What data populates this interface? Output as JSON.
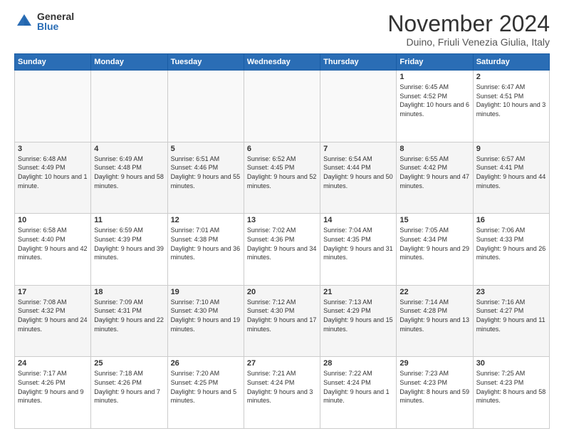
{
  "logo": {
    "general": "General",
    "blue": "Blue"
  },
  "title": "November 2024",
  "location": "Duino, Friuli Venezia Giulia, Italy",
  "weekdays": [
    "Sunday",
    "Monday",
    "Tuesday",
    "Wednesday",
    "Thursday",
    "Friday",
    "Saturday"
  ],
  "rows": [
    [
      {
        "day": "",
        "info": ""
      },
      {
        "day": "",
        "info": ""
      },
      {
        "day": "",
        "info": ""
      },
      {
        "day": "",
        "info": ""
      },
      {
        "day": "",
        "info": ""
      },
      {
        "day": "1",
        "info": "Sunrise: 6:45 AM\nSunset: 4:52 PM\nDaylight: 10 hours and 6 minutes."
      },
      {
        "day": "2",
        "info": "Sunrise: 6:47 AM\nSunset: 4:51 PM\nDaylight: 10 hours and 3 minutes."
      }
    ],
    [
      {
        "day": "3",
        "info": "Sunrise: 6:48 AM\nSunset: 4:49 PM\nDaylight: 10 hours and 1 minute."
      },
      {
        "day": "4",
        "info": "Sunrise: 6:49 AM\nSunset: 4:48 PM\nDaylight: 9 hours and 58 minutes."
      },
      {
        "day": "5",
        "info": "Sunrise: 6:51 AM\nSunset: 4:46 PM\nDaylight: 9 hours and 55 minutes."
      },
      {
        "day": "6",
        "info": "Sunrise: 6:52 AM\nSunset: 4:45 PM\nDaylight: 9 hours and 52 minutes."
      },
      {
        "day": "7",
        "info": "Sunrise: 6:54 AM\nSunset: 4:44 PM\nDaylight: 9 hours and 50 minutes."
      },
      {
        "day": "8",
        "info": "Sunrise: 6:55 AM\nSunset: 4:42 PM\nDaylight: 9 hours and 47 minutes."
      },
      {
        "day": "9",
        "info": "Sunrise: 6:57 AM\nSunset: 4:41 PM\nDaylight: 9 hours and 44 minutes."
      }
    ],
    [
      {
        "day": "10",
        "info": "Sunrise: 6:58 AM\nSunset: 4:40 PM\nDaylight: 9 hours and 42 minutes."
      },
      {
        "day": "11",
        "info": "Sunrise: 6:59 AM\nSunset: 4:39 PM\nDaylight: 9 hours and 39 minutes."
      },
      {
        "day": "12",
        "info": "Sunrise: 7:01 AM\nSunset: 4:38 PM\nDaylight: 9 hours and 36 minutes."
      },
      {
        "day": "13",
        "info": "Sunrise: 7:02 AM\nSunset: 4:36 PM\nDaylight: 9 hours and 34 minutes."
      },
      {
        "day": "14",
        "info": "Sunrise: 7:04 AM\nSunset: 4:35 PM\nDaylight: 9 hours and 31 minutes."
      },
      {
        "day": "15",
        "info": "Sunrise: 7:05 AM\nSunset: 4:34 PM\nDaylight: 9 hours and 29 minutes."
      },
      {
        "day": "16",
        "info": "Sunrise: 7:06 AM\nSunset: 4:33 PM\nDaylight: 9 hours and 26 minutes."
      }
    ],
    [
      {
        "day": "17",
        "info": "Sunrise: 7:08 AM\nSunset: 4:32 PM\nDaylight: 9 hours and 24 minutes."
      },
      {
        "day": "18",
        "info": "Sunrise: 7:09 AM\nSunset: 4:31 PM\nDaylight: 9 hours and 22 minutes."
      },
      {
        "day": "19",
        "info": "Sunrise: 7:10 AM\nSunset: 4:30 PM\nDaylight: 9 hours and 19 minutes."
      },
      {
        "day": "20",
        "info": "Sunrise: 7:12 AM\nSunset: 4:30 PM\nDaylight: 9 hours and 17 minutes."
      },
      {
        "day": "21",
        "info": "Sunrise: 7:13 AM\nSunset: 4:29 PM\nDaylight: 9 hours and 15 minutes."
      },
      {
        "day": "22",
        "info": "Sunrise: 7:14 AM\nSunset: 4:28 PM\nDaylight: 9 hours and 13 minutes."
      },
      {
        "day": "23",
        "info": "Sunrise: 7:16 AM\nSunset: 4:27 PM\nDaylight: 9 hours and 11 minutes."
      }
    ],
    [
      {
        "day": "24",
        "info": "Sunrise: 7:17 AM\nSunset: 4:26 PM\nDaylight: 9 hours and 9 minutes."
      },
      {
        "day": "25",
        "info": "Sunrise: 7:18 AM\nSunset: 4:26 PM\nDaylight: 9 hours and 7 minutes."
      },
      {
        "day": "26",
        "info": "Sunrise: 7:20 AM\nSunset: 4:25 PM\nDaylight: 9 hours and 5 minutes."
      },
      {
        "day": "27",
        "info": "Sunrise: 7:21 AM\nSunset: 4:24 PM\nDaylight: 9 hours and 3 minutes."
      },
      {
        "day": "28",
        "info": "Sunrise: 7:22 AM\nSunset: 4:24 PM\nDaylight: 9 hours and 1 minute."
      },
      {
        "day": "29",
        "info": "Sunrise: 7:23 AM\nSunset: 4:23 PM\nDaylight: 8 hours and 59 minutes."
      },
      {
        "day": "30",
        "info": "Sunrise: 7:25 AM\nSunset: 4:23 PM\nDaylight: 8 hours and 58 minutes."
      }
    ]
  ]
}
